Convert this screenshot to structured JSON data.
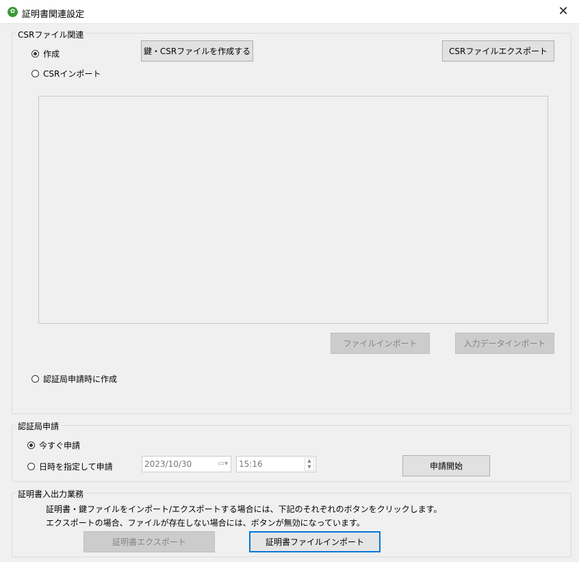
{
  "window": {
    "title": "証明書関連設定",
    "icon": "green-leaf-icon",
    "close_glyph": "✕"
  },
  "csr_group": {
    "legend": "CSRファイル関連",
    "radio_create": {
      "label": "作成",
      "checked": true
    },
    "radio_import": {
      "label": "CSRインポート",
      "checked": false
    },
    "create_key_button": "鍵・CSRファイルを作成する",
    "csr_export_button": "CSRファイルエクスポート",
    "csr_text": "",
    "file_import_button": "ファイルインポート",
    "input_data_import_button": "入力データインポート",
    "radio_ca_request": {
      "label": "認証局申請時に作成",
      "checked": false
    }
  },
  "ca_group": {
    "legend": "認証局申請",
    "radio_now": {
      "label": "今すぐ申請",
      "checked": true
    },
    "radio_scheduled": {
      "label": "日時を指定して申請",
      "checked": false
    },
    "date_value": "2023/10/30",
    "time_value": "15:16",
    "start_button": "申請開始"
  },
  "cert_group": {
    "legend": "証明書入出力業務",
    "note1": "証明書・鍵ファイルをインポート/エクスポートする場合には、下記のそれぞれのボタンをクリックします。",
    "note2": "エクスポートの場合、ファイルが存在しない場合には、ボタンが無効になっています。",
    "export_button": "証明書エクスポート",
    "import_button": "証明書ファイルインポート"
  },
  "colors": {
    "focus_border": "#0078d7",
    "disabled_text": "#838383"
  }
}
